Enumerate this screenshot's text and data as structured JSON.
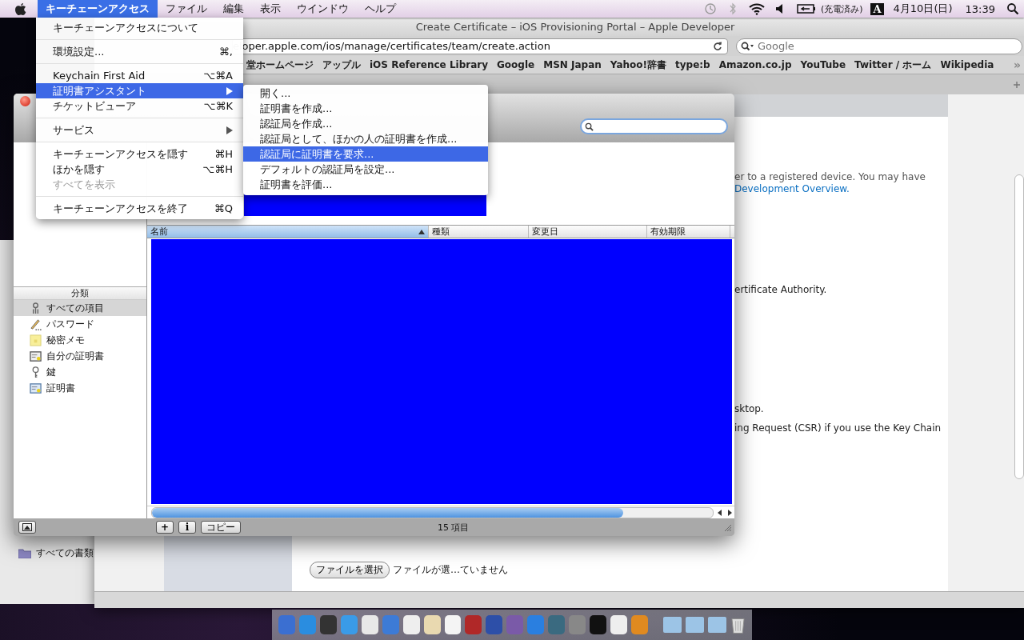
{
  "menubar": {
    "menus": [
      {
        "label": "キーチェーンアクセス",
        "selected": true
      },
      {
        "label": "ファイル",
        "selected": false
      },
      {
        "label": "編集",
        "selected": false
      },
      {
        "label": "表示",
        "selected": false
      },
      {
        "label": "ウインドウ",
        "selected": false
      },
      {
        "label": "ヘルプ",
        "selected": false
      }
    ],
    "battery": "(充電済み)",
    "input_mode": "A",
    "date": "4月10日(日)",
    "time": "13:39"
  },
  "app_menu": {
    "items": [
      {
        "kind": "item",
        "label": "キーチェーンアクセスについて",
        "selected": false,
        "disabled": false
      },
      {
        "kind": "separator"
      },
      {
        "kind": "item",
        "label": "環境設定...",
        "shortcut": "⌘,",
        "selected": false,
        "disabled": false
      },
      {
        "kind": "separator"
      },
      {
        "kind": "item",
        "label": "Keychain First Aid",
        "shortcut": "⌥⌘A",
        "selected": false,
        "disabled": false
      },
      {
        "kind": "submenu",
        "label": "証明書アシスタント",
        "selected": true,
        "disabled": false
      },
      {
        "kind": "item",
        "label": "チケットビューア",
        "shortcut": "⌥⌘K",
        "selected": false,
        "disabled": false
      },
      {
        "kind": "separator"
      },
      {
        "kind": "submenu",
        "label": "サービス",
        "selected": false,
        "disabled": false
      },
      {
        "kind": "separator"
      },
      {
        "kind": "item",
        "label": "キーチェーンアクセスを隠す",
        "shortcut": "⌘H",
        "selected": false,
        "disabled": false
      },
      {
        "kind": "item",
        "label": "ほかを隠す",
        "shortcut": "⌥⌘H",
        "selected": false,
        "disabled": false
      },
      {
        "kind": "item",
        "label": "すべてを表示",
        "selected": false,
        "disabled": true
      },
      {
        "kind": "separator"
      },
      {
        "kind": "item",
        "label": "キーチェーンアクセスを終了",
        "shortcut": "⌘Q",
        "selected": false,
        "disabled": false
      }
    ]
  },
  "submenu": {
    "items": [
      {
        "label": "開く...",
        "selected": false
      },
      {
        "label": "証明書を作成...",
        "selected": false
      },
      {
        "label": "認証局を作成...",
        "selected": false
      },
      {
        "label": "認証局として、ほかの人の証明書を作成...",
        "selected": false
      },
      {
        "label": "認証局に証明書を要求...",
        "selected": true
      },
      {
        "label": "デフォルトの認証局を設定...",
        "selected": false
      },
      {
        "label": "証明書を評価...",
        "selected": false
      }
    ]
  },
  "browser": {
    "title": "Create Certificate – iOS Provisioning Portal – Apple Developer",
    "url": "eloper.apple.com/ios/manage/certificates/team/create.action",
    "search_placeholder": "Google",
    "bookmarks": [
      "堂ホームページ",
      "アップル",
      "iOS Reference Library",
      "Google",
      "MSN Japan",
      "Yahoo!辞書",
      "type:b",
      "Amazon.co.jp",
      "YouTube",
      "Twitter / ホーム",
      "Wikipedia"
    ],
    "bookmarks_more": "»",
    "content_lines": [
      {
        "kind": "text",
        "text": "er to a registered device. You may have"
      },
      {
        "kind": "link",
        "text": "Development Overview."
      },
      {
        "kind": "text",
        "text": "ertificate Authority."
      },
      {
        "kind": "text",
        "text": "sktop."
      },
      {
        "kind": "text",
        "text": "ing Request (CSR) if you use the Key Chain"
      }
    ],
    "file_button": "ファイルを選択",
    "file_status": "ファイルが選…ていません"
  },
  "finder_sidebar": {
    "item": "すべての書類"
  },
  "keychain": {
    "category_header": "分類",
    "categories": [
      {
        "kind": "all",
        "label": "すべての項目",
        "selected": true
      },
      {
        "kind": "password",
        "label": "パスワード",
        "selected": false
      },
      {
        "kind": "note",
        "label": "秘密メモ",
        "selected": false
      },
      {
        "kind": "identity",
        "label": "自分の証明書",
        "selected": false
      },
      {
        "kind": "key",
        "label": "鍵",
        "selected": false
      },
      {
        "kind": "certificate",
        "label": "証明書",
        "selected": false
      }
    ],
    "columns": [
      {
        "label": "名前",
        "selected": true
      },
      {
        "label": "種類",
        "selected": false
      },
      {
        "label": "変更日",
        "selected": false
      },
      {
        "label": "有効期限",
        "selected": false
      }
    ],
    "add_button": "+",
    "info_button": "i",
    "copy_button": "コピー",
    "count": "15 項目"
  }
}
